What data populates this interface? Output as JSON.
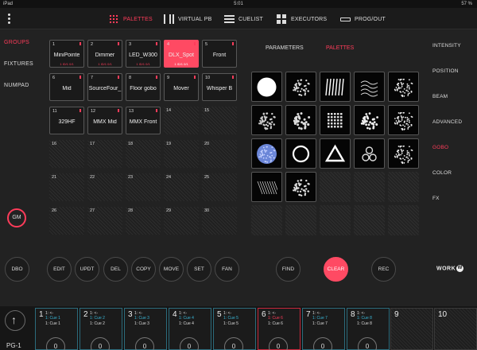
{
  "status": {
    "device": "iPad",
    "time": "5:01",
    "battery": "57 %"
  },
  "topnav": [
    {
      "label": "PALETTES",
      "icon": "palettes-grid-icon",
      "active": true
    },
    {
      "label": "VIRTUAL PB",
      "icon": "sliders-icon",
      "active": false
    },
    {
      "label": "CUELIST",
      "icon": "cuelist-icon",
      "active": false
    },
    {
      "label": "EXECUTORS",
      "icon": "executors-icon",
      "active": false
    },
    {
      "label": "PROG/OUT",
      "icon": "prog-out-icon",
      "active": false
    }
  ],
  "leftnav": [
    {
      "label": "GROUPS",
      "active": true
    },
    {
      "label": "FIXTURES",
      "active": false
    },
    {
      "label": "NUMPAD",
      "active": false
    }
  ],
  "rightnav": [
    {
      "label": "INTENSITY",
      "active": false
    },
    {
      "label": "POSITION",
      "active": false
    },
    {
      "label": "BEAM",
      "active": false
    },
    {
      "label": "ADVANCED",
      "active": false
    },
    {
      "label": "GOBO",
      "active": true
    },
    {
      "label": "COLOR",
      "active": false
    },
    {
      "label": "FX",
      "active": false
    }
  ],
  "groups": [
    {
      "num": "1",
      "name": "MiniPointe",
      "sub": "1 ID/1 0/1"
    },
    {
      "num": "2",
      "name": "Dimmer",
      "sub": "1 ID/1 0/1"
    },
    {
      "num": "3",
      "name": "LED_W300",
      "sub": "1 ID/1 0/1"
    },
    {
      "num": "4",
      "name": "DLX_Spot",
      "sub": "1 ID/1 0/1",
      "selected": true
    },
    {
      "num": "5",
      "name": "Front",
      "sub": ""
    },
    {
      "num": "6",
      "name": "Mid",
      "sub": ""
    },
    {
      "num": "7",
      "name": "SourceFour_",
      "sub": ""
    },
    {
      "num": "8",
      "name": "Floor gobo",
      "sub": ""
    },
    {
      "num": "9",
      "name": "Mover",
      "sub": ""
    },
    {
      "num": "10",
      "name": "Whisper B",
      "sub": ""
    },
    {
      "num": "11",
      "name": "329HF",
      "sub": ""
    },
    {
      "num": "12",
      "name": "MMX Mid",
      "sub": ""
    },
    {
      "num": "13",
      "name": "MMX Front",
      "sub": ""
    },
    {
      "num": "14",
      "name": "",
      "empty": true
    },
    {
      "num": "15",
      "name": "",
      "empty": true
    },
    {
      "num": "16",
      "name": "",
      "empty": true
    },
    {
      "num": "17",
      "name": "",
      "empty": true
    },
    {
      "num": "18",
      "name": "",
      "empty": true
    },
    {
      "num": "19",
      "name": "",
      "empty": true
    },
    {
      "num": "20",
      "name": "",
      "empty": true
    },
    {
      "num": "21",
      "name": "",
      "empty": true
    },
    {
      "num": "22",
      "name": "",
      "empty": true
    },
    {
      "num": "23",
      "name": "",
      "empty": true
    },
    {
      "num": "24",
      "name": "",
      "empty": true
    },
    {
      "num": "25",
      "name": "",
      "empty": true
    },
    {
      "num": "26",
      "name": "",
      "empty": true
    },
    {
      "num": "27",
      "name": "",
      "empty": true
    },
    {
      "num": "28",
      "name": "",
      "empty": true
    },
    {
      "num": "29",
      "name": "",
      "empty": true
    },
    {
      "num": "30",
      "name": "",
      "empty": true
    }
  ],
  "palette_tabs": {
    "parameters": "PARAMETERS",
    "palettes": "PALETTES"
  },
  "gobos": [
    "gobo-open-circle",
    "gobo-dots",
    "gobo-stripes",
    "gobo-waves",
    "gobo-speckle",
    "gobo-mesh",
    "gobo-breakup",
    "gobo-grid",
    "gobo-flower",
    "gobo-scatter",
    "gobo-blue-dots",
    "gobo-ring",
    "gobo-triangle",
    "gobo-triskelion",
    "gobo-fine-dots",
    "gobo-lines",
    "gobo-cells",
    "",
    "",
    "",
    "",
    "",
    "",
    "",
    ""
  ],
  "gm_label": "GM",
  "buttons": [
    "DBO",
    "EDIT",
    "UPDT",
    "DEL",
    "COPY",
    "MOVE",
    "SET",
    "FAN",
    "FIND",
    "CLEAR",
    "REC"
  ],
  "logo": "WORK",
  "logo_mark": "W",
  "page_label": "PG-1",
  "executors": [
    {
      "num": "1",
      "l1": "1: <-",
      "l2": "1: Cue 1",
      "l3": "1: Cue 1"
    },
    {
      "num": "2",
      "l1": "1: <-",
      "l2": "1: Cue 2",
      "l3": "1: Cue 2"
    },
    {
      "num": "3",
      "l1": "1: <-",
      "l2": "1: Cue 3",
      "l3": "1: Cue 3"
    },
    {
      "num": "4",
      "l1": "1: <-",
      "l2": "1: Cue 4",
      "l3": "1: Cue 4"
    },
    {
      "num": "5",
      "l1": "1: <-",
      "l2": "1: Cue 5",
      "l3": "1: Cue 5"
    },
    {
      "num": "6",
      "l1": "1: <-",
      "l2": "1: Cue 6",
      "l3": "1: Cue 6",
      "red": true
    },
    {
      "num": "7",
      "l1": "1: <-",
      "l2": "1: Cue 7",
      "l3": "1: Cue 7"
    },
    {
      "num": "8",
      "l1": "1: <-",
      "l2": "1: Cue 8",
      "l3": "1: Cue 8"
    },
    {
      "num": "9",
      "empty": true
    },
    {
      "num": "10",
      "empty": true
    }
  ],
  "knob_value": "0"
}
